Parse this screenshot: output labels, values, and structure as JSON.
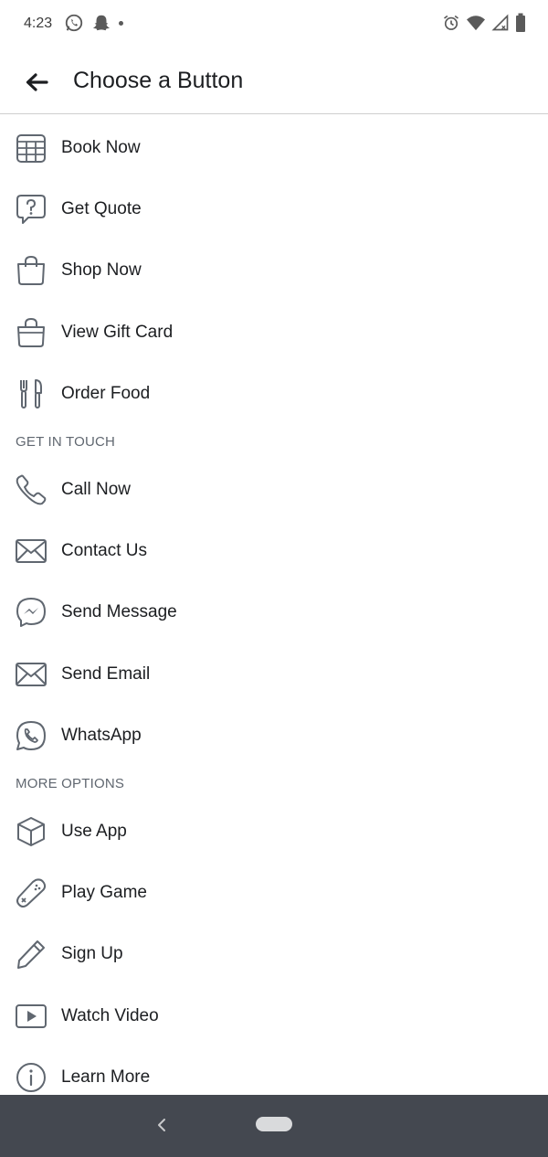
{
  "status_bar": {
    "time": "4:23",
    "left_icons": [
      "whatsapp-icon",
      "snapchat-icon",
      "notification-dot"
    ],
    "right_icons": [
      "alarm-icon",
      "wifi-icon",
      "signal-icon",
      "battery-icon"
    ]
  },
  "header": {
    "title": "Choose a Button",
    "back_icon": "arrow-left-icon"
  },
  "sections": [
    {
      "header": "",
      "items": [
        {
          "label": "Book Now",
          "icon": "calendar-icon"
        },
        {
          "label": "Get Quote",
          "icon": "question-bubble-icon"
        },
        {
          "label": "Shop Now",
          "icon": "shopping-bag-icon"
        },
        {
          "label": "View Gift Card",
          "icon": "gift-bag-icon"
        },
        {
          "label": "Order Food",
          "icon": "cutlery-icon"
        }
      ]
    },
    {
      "header": "GET IN TOUCH",
      "items": [
        {
          "label": "Call Now",
          "icon": "phone-icon"
        },
        {
          "label": "Contact Us",
          "icon": "envelope-icon"
        },
        {
          "label": "Send Message",
          "icon": "messenger-icon"
        },
        {
          "label": "Send Email",
          "icon": "envelope-icon"
        },
        {
          "label": "WhatsApp",
          "icon": "whatsapp-icon"
        }
      ]
    },
    {
      "header": "MORE OPTIONS",
      "items": [
        {
          "label": "Use App",
          "icon": "cube-icon"
        },
        {
          "label": "Play Game",
          "icon": "gamepad-icon"
        },
        {
          "label": "Sign Up",
          "icon": "pencil-icon"
        },
        {
          "label": "Watch Video",
          "icon": "play-video-icon"
        },
        {
          "label": "Learn More",
          "icon": "info-icon"
        }
      ]
    }
  ],
  "colors": {
    "text": "#1c1e21",
    "section_header": "#606770",
    "icon_stroke": "#606770",
    "nav_bar": "#444850",
    "divider": "#cfcfcf"
  }
}
